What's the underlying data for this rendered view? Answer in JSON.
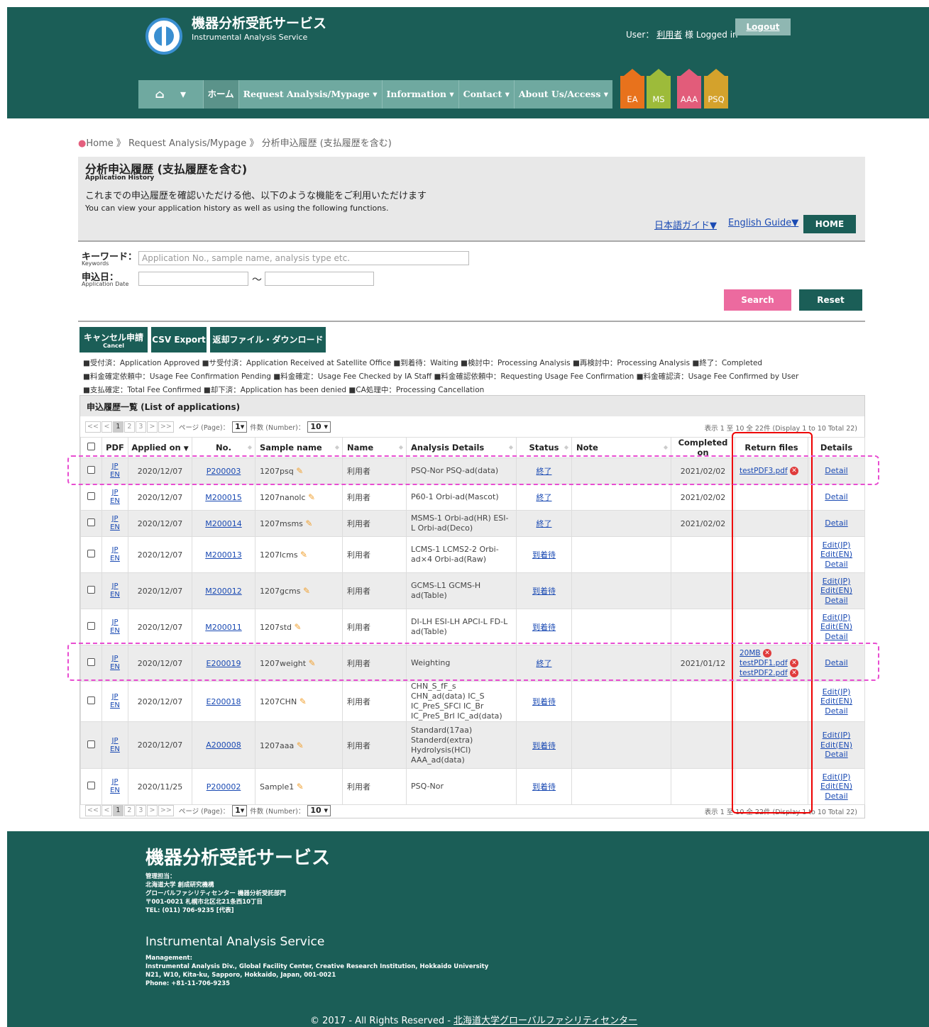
{
  "header": {
    "title": "機器分析受託サービス",
    "subtitle": "Instrumental Analysis Service",
    "user_prefix": "User：",
    "user_name": "利用者",
    "user_suffix": "様 Logged in",
    "logout": "Logout"
  },
  "nav": {
    "home_label": "ホーム",
    "items": [
      "Request Analysis/Mypage ▾",
      "Information ▾",
      "Contact ▾",
      "About Us/Access ▾"
    ],
    "tabs": [
      "EA",
      "MS",
      "AAA",
      "PSQ"
    ],
    "tab_colors": [
      "#e8721c",
      "#9dbb3a",
      "#e25c7a",
      "#d4a22c"
    ]
  },
  "breadcrumb": {
    "home": "Home",
    "sep": "》",
    "level1": "Request Analysis/Mypage",
    "level2": "分析申込履歴 (支払履歴を含む)"
  },
  "title_box": {
    "title": "分析申込履歴 (支払履歴を含む)",
    "title_en": "Application History",
    "desc_jp": "これまでの申込履歴を確認いただける他、以下のような機能をご利用いただけます",
    "desc_en": "You can view your application history as well as using the following functions.",
    "guide_jp": "日本語ガイド▼",
    "guide_en": "English Guide▼",
    "home_btn": "HOME"
  },
  "search": {
    "keyword_label": "キーワード：",
    "keyword_label_en": "Keywords",
    "keyword_placeholder": "Application No., sample name, analysis type etc.",
    "date_label": "申込日：",
    "date_label_en": "Application Date",
    "tilde": "～",
    "search_btn": "Search",
    "reset_btn": "Reset"
  },
  "actions": {
    "cancel": "キャンセル申請",
    "cancel_en": "Cancel",
    "csv": "CSV Export",
    "download": "返却ファイル・ダウンロード"
  },
  "legend": [
    "■受付済：Application Approved ■サ受付済：Application Received at Satellite Office ■到着待：Waiting ■検討中：Processing Analysis ■再検討中：Processing Analysis ■終了：Completed",
    "■料金確定依頼中：Usage Fee Confirmation Pending ■料金確定：Usage Fee Checked by IA Staff ■料金確認依頼中：Requesting Usage Fee Confirmation ■料金確認済：Usage Fee Confirmed by User",
    "■支払確定：Total Fee Confirmed ■却下済：Application has been denied ■CA処理中：Processing Cancellation"
  ],
  "list": {
    "title": "申込履歴一覧 (List of applications)",
    "pager": {
      "first": "<<",
      "prev": "<",
      "pages": [
        "1",
        "2",
        "3"
      ],
      "next": ">",
      "last": ">>",
      "page_label": "ページ (Page)：",
      "page_value": "1▾",
      "num_label": "件数 (Number)：",
      "num_value": "10 ▾",
      "info": "表示 1 至 10 全 22件 (Display 1 to 10 Total 22)"
    },
    "columns": [
      "PDF",
      "Applied on",
      "No.",
      "Sample name",
      "Name",
      "Analysis Details",
      "Status",
      "Note",
      "Completed on",
      "Return files",
      "Details"
    ],
    "rows": [
      {
        "date": "2020/12/07",
        "no": "P200003",
        "sample": "1207psq",
        "name": "利用者",
        "analysis": "PSQ-Nor  PSQ-ad(data)",
        "status": "終了",
        "completed": "2021/02/02",
        "files": [
          "testPDF3.pdf"
        ],
        "details": [
          "Detail"
        ]
      },
      {
        "date": "2020/12/07",
        "no": "M200015",
        "sample": "1207nanolc",
        "name": "利用者",
        "analysis": "P60-1  Orbi-ad(Mascot)",
        "status": "終了",
        "completed": "2021/02/02",
        "files": [],
        "details": [
          "Detail"
        ]
      },
      {
        "date": "2020/12/07",
        "no": "M200014",
        "sample": "1207msms",
        "name": "利用者",
        "analysis": "MSMS-1  Orbi-ad(HR)  ESI-L  Orbi-ad(Deco)",
        "status": "終了",
        "completed": "2021/02/02",
        "files": [],
        "details": [
          "Detail"
        ]
      },
      {
        "date": "2020/12/07",
        "no": "M200013",
        "sample": "1207lcms",
        "name": "利用者",
        "analysis": "LCMS-1  LCMS2-2  Orbi-ad×4  Orbi-ad(Raw)",
        "status": "到着待",
        "completed": "",
        "files": [],
        "details": [
          "Edit(JP)",
          "Edit(EN)",
          "Detail"
        ]
      },
      {
        "date": "2020/12/07",
        "no": "M200012",
        "sample": "1207gcms",
        "name": "利用者",
        "analysis": "GCMS-L1  GCMS-H ad(Table)",
        "status": "到着待",
        "completed": "",
        "files": [],
        "details": [
          "Edit(JP)",
          "Edit(EN)",
          "Detail"
        ]
      },
      {
        "date": "2020/12/07",
        "no": "M200011",
        "sample": "1207std",
        "name": "利用者",
        "analysis": "DI-LH  ESI-LH  APCI-L FD-L  ad(Table)",
        "status": "到着待",
        "completed": "",
        "files": [],
        "details": [
          "Edit(JP)",
          "Edit(EN)",
          "Detail"
        ]
      },
      {
        "date": "2020/12/07",
        "no": "E200019",
        "sample": "1207weight",
        "name": "利用者",
        "analysis": "Weighting",
        "status": "終了",
        "completed": "2021/01/12",
        "files": [
          "20MB",
          "testPDF1.pdf",
          "testPDF2.pdf"
        ],
        "details": [
          "Detail"
        ]
      },
      {
        "date": "2020/12/07",
        "no": "E200018",
        "sample": "1207CHN",
        "name": "利用者",
        "analysis": "CHN_S_fF_s  CHN_ad(data) IC_S  IC_PreS_SFCl  IC_Br IC_PreS_BrI  IC_ad(data)",
        "status": "到着待",
        "completed": "",
        "files": [],
        "details": [
          "Edit(JP)",
          "Edit(EN)",
          "Detail"
        ]
      },
      {
        "date": "2020/12/07",
        "no": "A200008",
        "sample": "1207aaa",
        "name": "利用者",
        "analysis": "Standard(17aa) Standerd(extra) Hydrolysis(HCl) AAA_ad(data)",
        "status": "到着待",
        "completed": "",
        "files": [],
        "details": [
          "Edit(JP)",
          "Edit(EN)",
          "Detail"
        ]
      },
      {
        "date": "2020/11/25",
        "no": "P200002",
        "sample": "Sample1",
        "name": "利用者",
        "analysis": "PSQ-Nor",
        "status": "到着待",
        "completed": "",
        "files": [],
        "details": [
          "Edit(JP)",
          "Edit(EN)",
          "Detail"
        ]
      }
    ],
    "pdf_jp": "JP",
    "pdf_en": "EN"
  },
  "footer": {
    "title": "機器分析受託サービス",
    "jp_lines": [
      "管理担当：",
      "北海道大学 創成研究機構",
      "グローバルファシリティセンター 機器分析受託部門",
      "〒001-0021 札幌市北区北21条西10丁目",
      "TEL: (011) 706-9235 [代表]"
    ],
    "en_title": "Instrumental Analysis Service",
    "en_lines": [
      "Management:",
      "Instrumental Analysis Div., Global Facility Center, Creative Research Institution, Hokkaido University",
      "N21, W10, Kita-ku, Sapporo, Hokkaido, Japan, 001-0021",
      "Phone: +81-11-706-9235"
    ],
    "copyright": "© 2017 - All Rights Reserved - ",
    "copyright_link": "北海道大学グローバルファシリティセンター"
  }
}
